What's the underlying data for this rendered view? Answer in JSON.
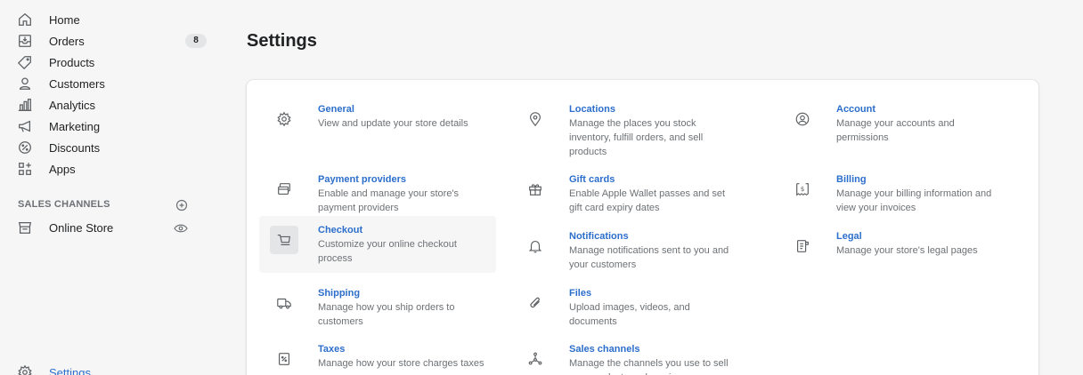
{
  "sidebar": {
    "items": [
      {
        "label": "Home",
        "icon": "home-icon"
      },
      {
        "label": "Orders",
        "icon": "orders-icon",
        "badge": "8"
      },
      {
        "label": "Products",
        "icon": "tag-icon"
      },
      {
        "label": "Customers",
        "icon": "customer-icon"
      },
      {
        "label": "Analytics",
        "icon": "analytics-icon"
      },
      {
        "label": "Marketing",
        "icon": "megaphone-icon"
      },
      {
        "label": "Discounts",
        "icon": "discount-icon"
      },
      {
        "label": "Apps",
        "icon": "apps-icon"
      }
    ],
    "sales_channels_title": "SALES CHANNELS",
    "online_store_label": "Online Store",
    "settings_label": "Settings"
  },
  "page": {
    "title": "Settings"
  },
  "settings": [
    {
      "title": "General",
      "desc": "View and update your store details"
    },
    {
      "title": "Locations",
      "desc": "Manage the places you stock inventory, fulfill orders, and sell products"
    },
    {
      "title": "Account",
      "desc": "Manage your accounts and permissions"
    },
    {
      "title": "Payment providers",
      "desc": "Enable and manage your store's payment providers"
    },
    {
      "title": "Gift cards",
      "desc": "Enable Apple Wallet passes and set gift card expiry dates"
    },
    {
      "title": "Billing",
      "desc": "Manage your billing information and view your invoices"
    },
    {
      "title": "Checkout",
      "desc": "Customize your online checkout process"
    },
    {
      "title": "Notifications",
      "desc": "Manage notifications sent to you and your customers"
    },
    {
      "title": "Legal",
      "desc": "Manage your store's legal pages"
    },
    {
      "title": "Shipping",
      "desc": "Manage how you ship orders to customers"
    },
    {
      "title": "Files",
      "desc": "Upload images, videos, and documents"
    },
    {
      "title": "Taxes",
      "desc": "Manage how your store charges taxes"
    },
    {
      "title": "Sales channels",
      "desc": "Manage the channels you use to sell your products and services"
    }
  ],
  "colors": {
    "link": "#2c6ecb",
    "text": "#202223",
    "subdued": "#6d7175",
    "background": "#f6f6f7"
  }
}
